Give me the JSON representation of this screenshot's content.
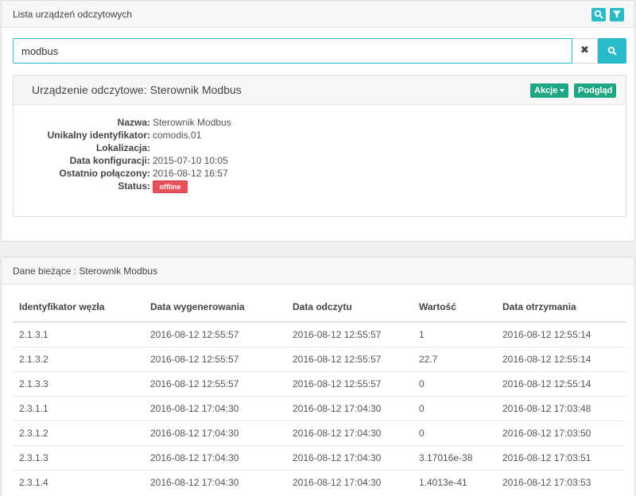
{
  "devices_panel": {
    "title": "Lista urządzeń odczytowych",
    "header_buttons": [
      {
        "icon": "search-icon"
      },
      {
        "icon": "filter-icon"
      }
    ],
    "search": {
      "value": "modbus",
      "clear_glyph": "✖"
    },
    "device": {
      "title": "Urządzenie odczytowe: Sterownik Modbus",
      "actions_label": "Akcje",
      "preview_label": "Podgląd",
      "fields": [
        {
          "label": "Nazwa:",
          "value": "Sterownik Modbus"
        },
        {
          "label": "Unikalny identyfikator:",
          "value": "comodis.01"
        },
        {
          "label": "Lokalizacja:",
          "value": ""
        },
        {
          "label": "Data konfiguracji:",
          "value": "2015-07-10 10:05"
        },
        {
          "label": "Ostatnio połączony:",
          "value": "2016-08-12 16:57"
        },
        {
          "label": "Status:",
          "value": "offline"
        }
      ],
      "status_color": "#e8505b"
    }
  },
  "current_panel": {
    "title": "Dane bieżące : Sterownik Modbus",
    "columns": [
      "Identyfikator węzła",
      "Data wygenerowania",
      "Data odczytu",
      "Wartość",
      "Data otrzymania"
    ],
    "rows": [
      [
        "2.1.3.1",
        "2016-08-12 12:55:57",
        "2016-08-12 12:55:57",
        "1",
        "2016-08-12 12:55:14"
      ],
      [
        "2.1.3.2",
        "2016-08-12 12:55:57",
        "2016-08-12 12:55:57",
        "22.7",
        "2016-08-12 12:55:14"
      ],
      [
        "2.1.3.3",
        "2016-08-12 12:55:57",
        "2016-08-12 12:55:57",
        "0",
        "2016-08-12 12:55:14"
      ],
      [
        "2.3.1.1",
        "2016-08-12 17:04:30",
        "2016-08-12 17:04:30",
        "0",
        "2016-08-12 17:03:48"
      ],
      [
        "2.3.1.2",
        "2016-08-12 17:04:30",
        "2016-08-12 17:04:30",
        "0",
        "2016-08-12 17:03:50"
      ],
      [
        "2.3.1.3",
        "2016-08-12 17:04:30",
        "2016-08-12 17:04:30",
        "3.17016e-38",
        "2016-08-12 17:03:51"
      ],
      [
        "2.3.1.4",
        "2016-08-12 17:04:30",
        "2016-08-12 17:04:30",
        "1.4013e-41",
        "2016-08-12 17:03:53"
      ]
    ]
  },
  "colors": {
    "accent": "#2bbac8",
    "action_green": "#1fa783",
    "offline_red": "#e8505b"
  }
}
